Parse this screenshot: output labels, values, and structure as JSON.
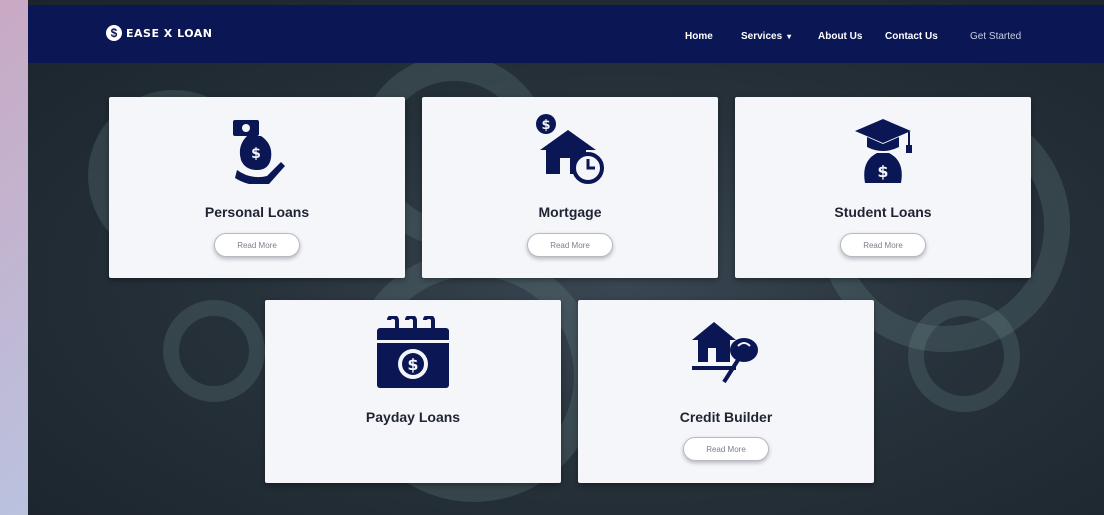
{
  "brand": {
    "name": "EASE X LOAN",
    "coin": "$"
  },
  "nav": {
    "home": "Home",
    "services": "Services",
    "services_caret": "▾",
    "about": "About Us",
    "contact": "Contact Us",
    "get_started": "Get Started"
  },
  "cards": [
    {
      "title": "Personal Loans",
      "button": "Read More",
      "icon": "hand-money-bag-icon"
    },
    {
      "title": "Mortgage",
      "button": "Read More",
      "icon": "house-clock-coin-icon"
    },
    {
      "title": "Student Loans",
      "button": "Read More",
      "icon": "graduation-money-bag-icon"
    },
    {
      "title": "Payday Loans",
      "icon": "calendar-dollar-icon"
    },
    {
      "title": "Credit Builder",
      "button": "Read More",
      "icon": "house-brush-icon"
    }
  ],
  "colors": {
    "navbar": "#0b1655",
    "icon": "#0b1655",
    "card": "#f5f6fa",
    "background": "#26313a"
  }
}
